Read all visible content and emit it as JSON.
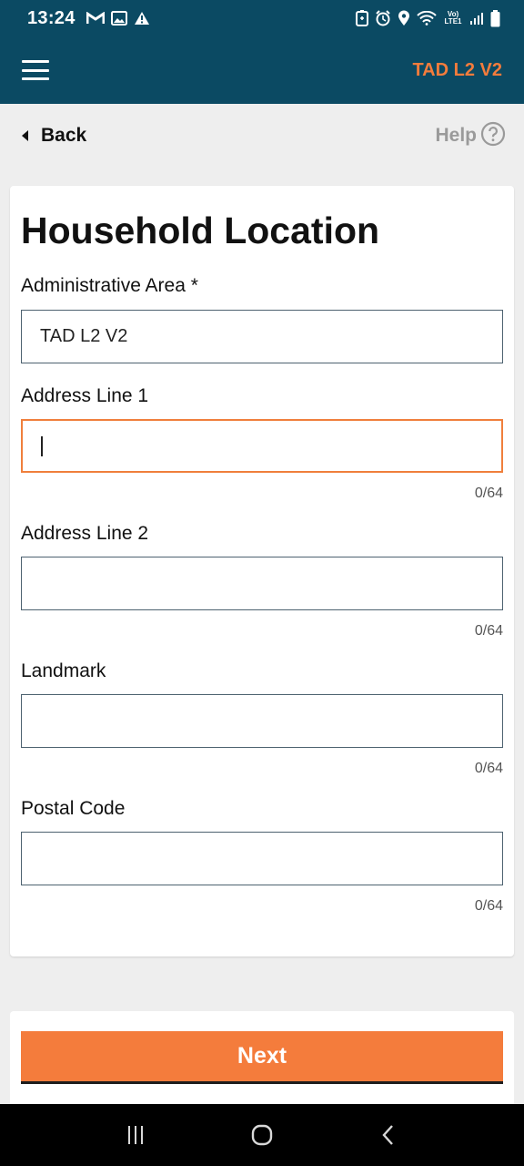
{
  "status_bar": {
    "time": "13:24",
    "left_icons": [
      "gmail-icon",
      "image-icon",
      "warning-icon"
    ],
    "right_icons": [
      "battery-saver-icon",
      "alarm-icon",
      "location-icon",
      "wifi-icon",
      "volte-icon",
      "signal-icon",
      "battery-icon"
    ],
    "volte_text": "Vo) LTE1"
  },
  "app_bar": {
    "title": "TAD L2 V2",
    "title_color": "#f47c3c",
    "background": "#0b4a63"
  },
  "nav": {
    "back_label": "Back",
    "help_label": "Help"
  },
  "form": {
    "title": "Household Location",
    "fields": [
      {
        "label": "Administrative Area *",
        "value": "TAD L2 V2"
      },
      {
        "label": "Address Line 1",
        "value": "",
        "counter": "0/64"
      },
      {
        "label": "Address Line 2",
        "value": "",
        "counter": "0/64"
      },
      {
        "label": "Landmark",
        "value": "",
        "counter": "0/64"
      },
      {
        "label": "Postal Code",
        "value": "",
        "counter": "0/64"
      }
    ]
  },
  "footer": {
    "next_label": "Next",
    "accent": "#f47c3c"
  },
  "system_nav": [
    "recent-apps-icon",
    "home-icon",
    "back-nav-icon"
  ]
}
